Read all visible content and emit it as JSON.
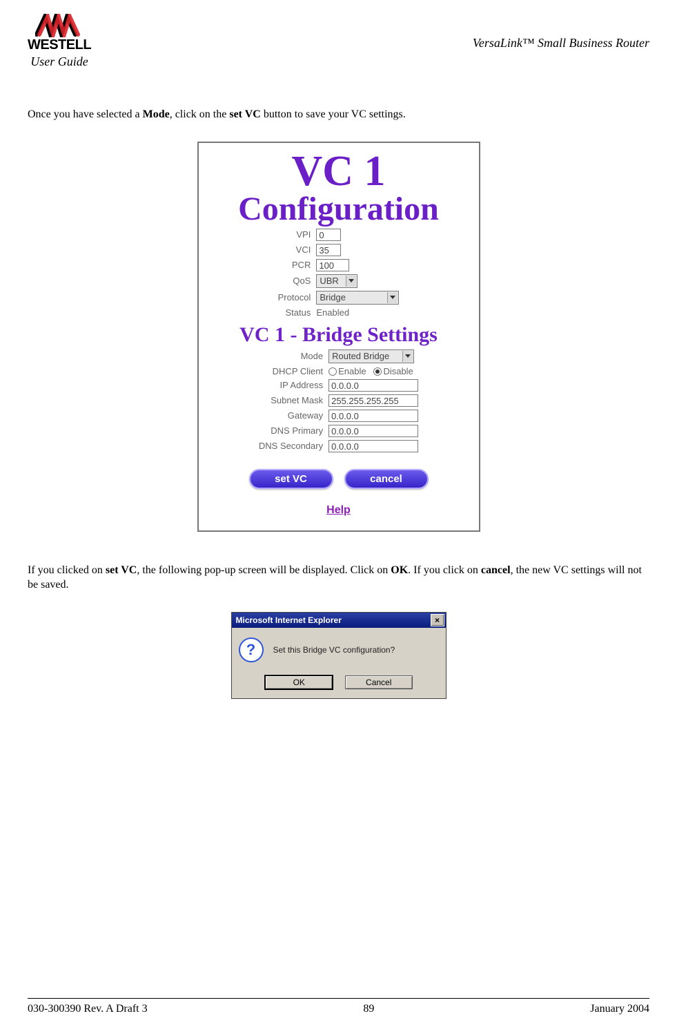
{
  "header": {
    "brand_line1": "WESTELL",
    "user_guide": "User Guide",
    "device": "VersaLink™  Small Business Router"
  },
  "para1": {
    "pre": "Once you have selected a ",
    "b1": "Mode",
    "mid": ", click on the ",
    "b2": "set VC",
    "post": " button to save your VC settings."
  },
  "config": {
    "title_l1": "VC 1",
    "title_l2": "Configuration",
    "fields": {
      "vpi_label": "VPI",
      "vpi": "0",
      "vci_label": "VCI",
      "vci": "35",
      "pcr_label": "PCR",
      "pcr": "100",
      "qos_label": "QoS",
      "qos": "UBR",
      "protocol_label": "Protocol",
      "protocol": "Bridge",
      "status_label": "Status",
      "status_value": "Enabled"
    },
    "bridge_title": "VC 1 - Bridge Settings",
    "bridge_fields": {
      "mode_label": "Mode",
      "mode": "Routed Bridge",
      "dhcp_label": "DHCP Client",
      "dhcp_enable": "Enable",
      "dhcp_disable": "Disable",
      "ip_label": "IP Address",
      "ip": "0.0.0.0",
      "mask_label": "Subnet Mask",
      "mask": "255.255.255.255",
      "gw_label": "Gateway",
      "gw": "0.0.0.0",
      "dns1_label": "DNS Primary",
      "dns1": "0.0.0.0",
      "dns2_label": "DNS Secondary",
      "dns2": "0.0.0.0"
    },
    "buttons": {
      "set": "set VC",
      "cancel": "cancel"
    },
    "help": "Help"
  },
  "para2": {
    "pre": "If you clicked on ",
    "b1": "set VC",
    "mid1": ", the following pop-up screen will be displayed. Click on ",
    "b2": "OK",
    "mid2": ". If you click on ",
    "b3": "cancel",
    "post": ", the new VC settings will not be saved."
  },
  "dialog": {
    "title": "Microsoft Internet Explorer",
    "close": "×",
    "question_mark": "?",
    "message": "Set this Bridge VC configuration?",
    "ok": "OK",
    "cancel": "Cancel"
  },
  "footer": {
    "left": "030-300390 Rev. A Draft 3",
    "center": "89",
    "right": "January 2004"
  }
}
